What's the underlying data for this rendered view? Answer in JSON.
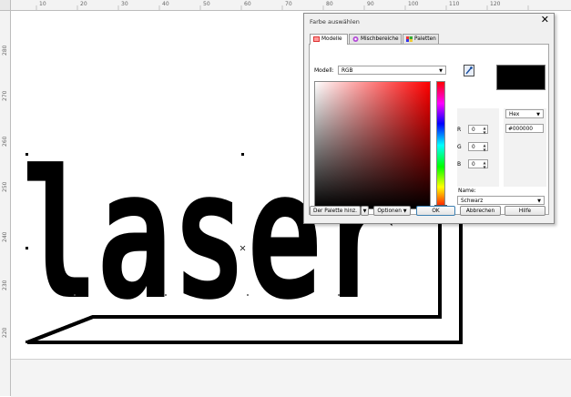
{
  "ruler": {
    "h_ticks": [
      "10",
      "20",
      "30",
      "40",
      "50",
      "60",
      "70",
      "80",
      "90",
      "100",
      "110",
      "120"
    ],
    "v_ticks": [
      "280",
      "270",
      "260",
      "250",
      "240",
      "230",
      "220"
    ]
  },
  "canvas": {
    "artwork_text": "laser"
  },
  "dialog": {
    "title": "Farbe auswählen",
    "close_glyph": "✕",
    "tabs": [
      {
        "label": "Modelle",
        "active": true
      },
      {
        "label": "Mischbereiche",
        "active": false
      },
      {
        "label": "Paletten",
        "active": false
      }
    ],
    "model_label": "Modell:",
    "model_value": "RGB",
    "format_value": "Hex",
    "hex_value": "#000000",
    "components": [
      {
        "label": "R",
        "value": "0"
      },
      {
        "label": "G",
        "value": "0"
      },
      {
        "label": "B",
        "value": "0"
      }
    ],
    "name_label": "Name:",
    "name_value": "Schwarz",
    "buttons": {
      "add_palette": "Der Palette hinz.",
      "options": "Optionen",
      "ok": "OK",
      "cancel": "Abbrechen",
      "help": "Hilfe"
    },
    "current_color": "#000000",
    "accent": "#3c7fb1"
  }
}
